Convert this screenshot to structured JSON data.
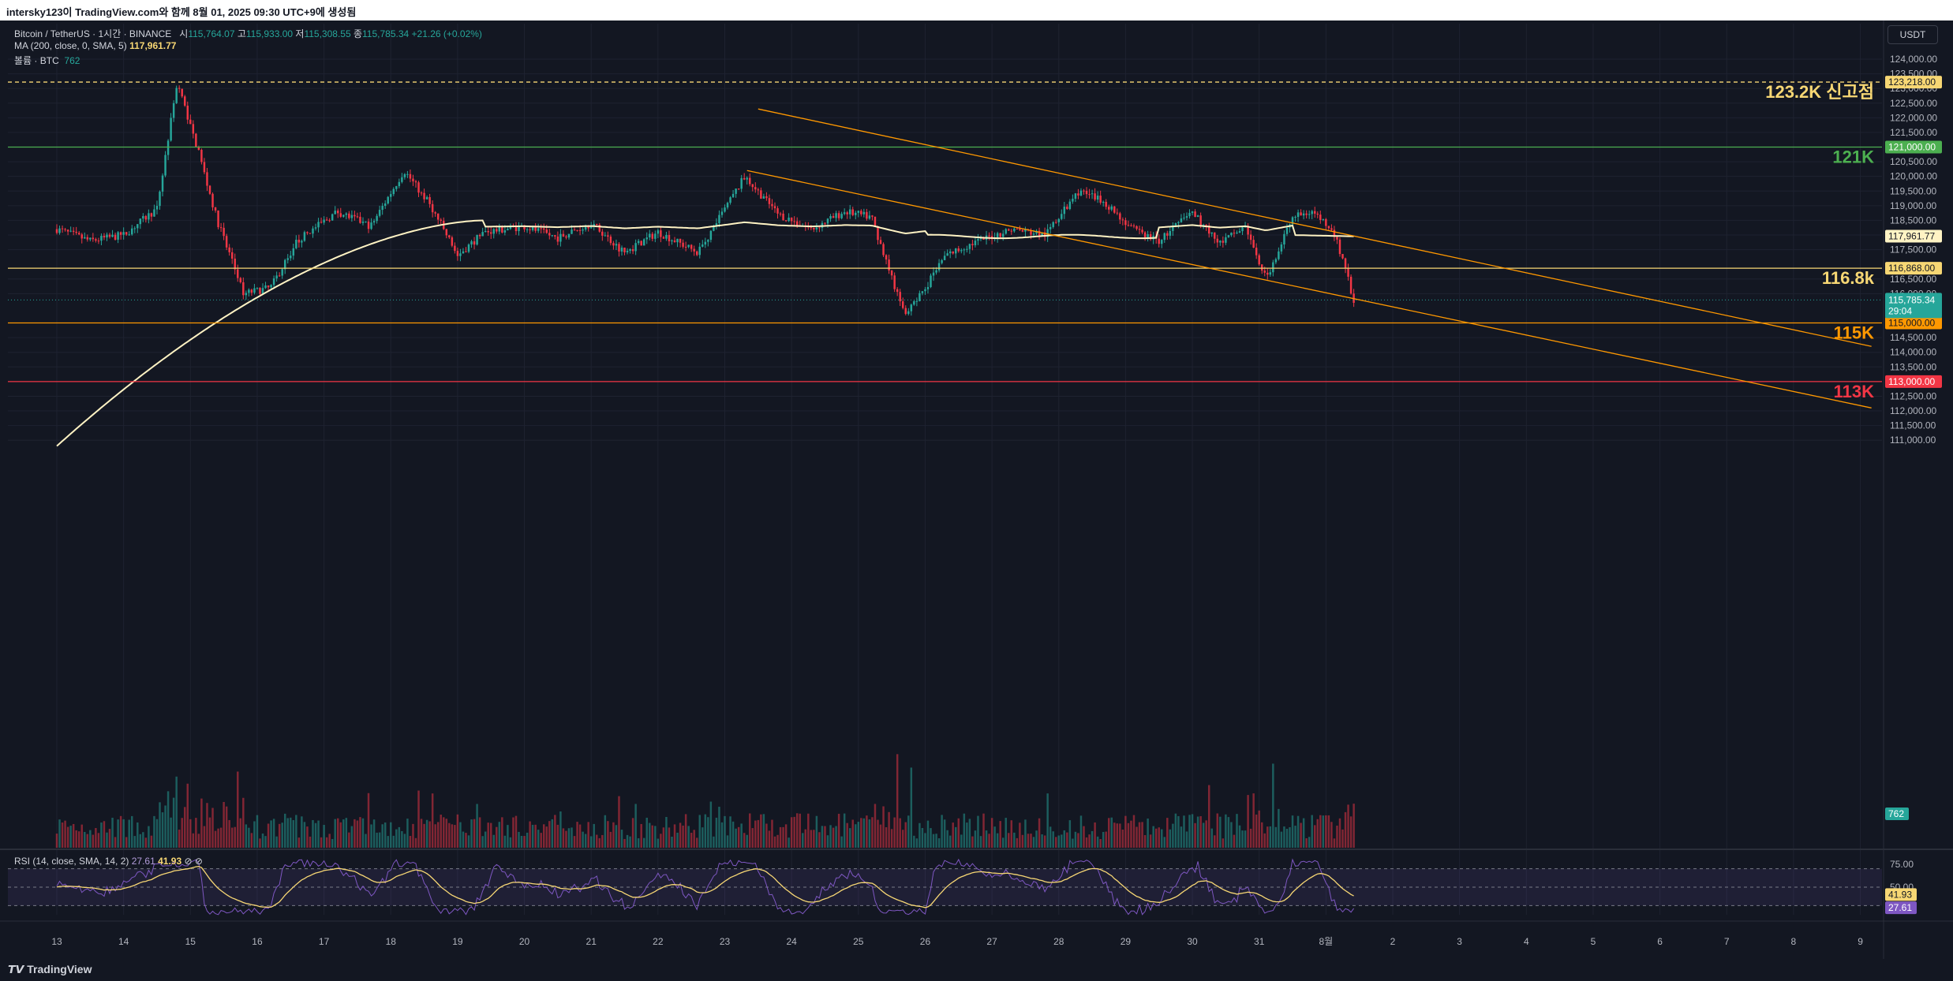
{
  "window": {
    "title": "intersky123이 TradingView.com와 함께 8월 01, 2025 09:30 UTC+9에 생성됨"
  },
  "legend": {
    "symbol": "Bitcoin / TetherUS · 1시간 · BINANCE",
    "open_label": "시",
    "open": "115,764.07",
    "high_label": "고",
    "high": "115,933.00",
    "low_label": "저",
    "low": "115,308.55",
    "close_label": "종",
    "close": "115,785.34",
    "change": "+21.26 (+0.02%)",
    "ma_label": "MA (200, close, 0, SMA, 5)",
    "ma_value": "117,961.77",
    "volume_label": "볼륨 · BTC",
    "volume_value": "762",
    "rsi_label": "RSI (14, close, SMA, 14, 2)",
    "rsi_value": "27.61",
    "rsi_ma_value": "41.93"
  },
  "currency_button": "USDT",
  "price_axis": {
    "ticks": [
      "124,000.00",
      "123,500.00",
      "123,000.00",
      "122,500.00",
      "122,000.00",
      "121,500.00",
      "120,500.00",
      "120,000.00",
      "119,500.00",
      "119,000.00",
      "118,500.00",
      "118,000.00",
      "117,500.00",
      "116,500.00",
      "116,000.00",
      "114,500.00",
      "114,000.00",
      "113,500.00",
      "112,500.00",
      "112,000.00",
      "111,500.00",
      "111,000.00"
    ],
    "tick_values": [
      124000,
      123500,
      123000,
      122500,
      122000,
      121500,
      120500,
      120000,
      119500,
      119000,
      118500,
      118000,
      117500,
      116500,
      116000,
      114500,
      114000,
      113500,
      112500,
      112000,
      111500,
      111000
    ],
    "badges": [
      {
        "label": "123,218.00",
        "value": 123218,
        "color": "#f7d774",
        "text": "#131722"
      },
      {
        "label": "121,000.00",
        "value": 121000,
        "color": "#4caf50",
        "text": "#ffffff"
      },
      {
        "label": "117,961.77",
        "value": 117961.77,
        "color": "#fff3c4",
        "text": "#131722"
      },
      {
        "label": "116,868.00",
        "value": 116868,
        "color": "#f7d774",
        "text": "#131722"
      },
      {
        "label": "115,000.00",
        "value": 115000,
        "color": "#ff9800",
        "text": "#131722"
      },
      {
        "label": "113,000.00",
        "value": 113000,
        "color": "#f23645",
        "text": "#ffffff"
      }
    ],
    "last_price": "115,785.34",
    "last_price_value": 115785.34,
    "countdown": "29:04",
    "volume_badge": "762"
  },
  "levels": [
    {
      "label": "123.2K 신고점",
      "value": 123218,
      "color": "#f7d774",
      "style": "dashed"
    },
    {
      "label": "121K",
      "value": 121000,
      "color": "#4caf50",
      "style": "solid"
    },
    {
      "label": "116.8k",
      "value": 116868,
      "color": "#f7d774",
      "style": "solid"
    },
    {
      "label": "115K",
      "value": 115000,
      "color": "#ff9800",
      "style": "solid"
    },
    {
      "label": "113K",
      "value": 113000,
      "color": "#f23645",
      "style": "solid"
    }
  ],
  "trendlines": [
    {
      "from": [
        "Jul 23 12:00",
        122300
      ],
      "to": [
        "Aug 9 04:00",
        114200
      ],
      "color": "#ff9800"
    },
    {
      "from": [
        "Jul 23 08:00",
        120200
      ],
      "to": [
        "Aug 9 04:00",
        112100
      ],
      "color": "#ff9800"
    }
  ],
  "rsi_axis": {
    "ticks": [
      "75.00",
      "50.00"
    ],
    "tick_values": [
      75,
      50
    ],
    "badges": [
      {
        "label": "41.93",
        "value": 41.93,
        "color": "#f7d774",
        "text": "#131722"
      },
      {
        "label": "27.61",
        "value": 27.61,
        "color": "#7e57c2",
        "text": "#ffffff"
      }
    ]
  },
  "time_axis": [
    "13",
    "14",
    "15",
    "16",
    "17",
    "18",
    "19",
    "20",
    "21",
    "22",
    "23",
    "24",
    "25",
    "26",
    "27",
    "28",
    "29",
    "30",
    "31",
    "8월",
    "2",
    "3",
    "4",
    "5",
    "6",
    "7",
    "8",
    "9"
  ],
  "chart_data": [
    {
      "type": "candlestick",
      "title": "Bitcoin / TetherUS · 1시간 · BINANCE",
      "x_dates": [
        "2025-07-13",
        "2025-07-14",
        "2025-07-15",
        "2025-07-16",
        "2025-07-17",
        "2025-07-18",
        "2025-07-19",
        "2025-07-20",
        "2025-07-21",
        "2025-07-22",
        "2025-07-23",
        "2025-07-24",
        "2025-07-25",
        "2025-07-26",
        "2025-07-27",
        "2025-07-28",
        "2025-07-29",
        "2025-07-30",
        "2025-07-31",
        "2025-08-01"
      ],
      "daily_close_approx": [
        117800,
        119600,
        117200,
        118300,
        119100,
        118200,
        117600,
        117900,
        117500,
        118800,
        118200,
        118300,
        116200,
        117800,
        118300,
        118900,
        118100,
        117900,
        118100,
        115785
      ],
      "ylim": [
        110800,
        124300
      ],
      "grid": true,
      "colors": {
        "up": "#26a69a",
        "down": "#f23645",
        "ma": "#fff3c4"
      }
    },
    {
      "type": "line",
      "title": "RSI (14, close, SMA, 14, 2)",
      "ylim": [
        20,
        80
      ],
      "levels": [
        70,
        50,
        30
      ],
      "last_rsi": 27.61,
      "last_rsi_ma": 41.93
    }
  ]
}
